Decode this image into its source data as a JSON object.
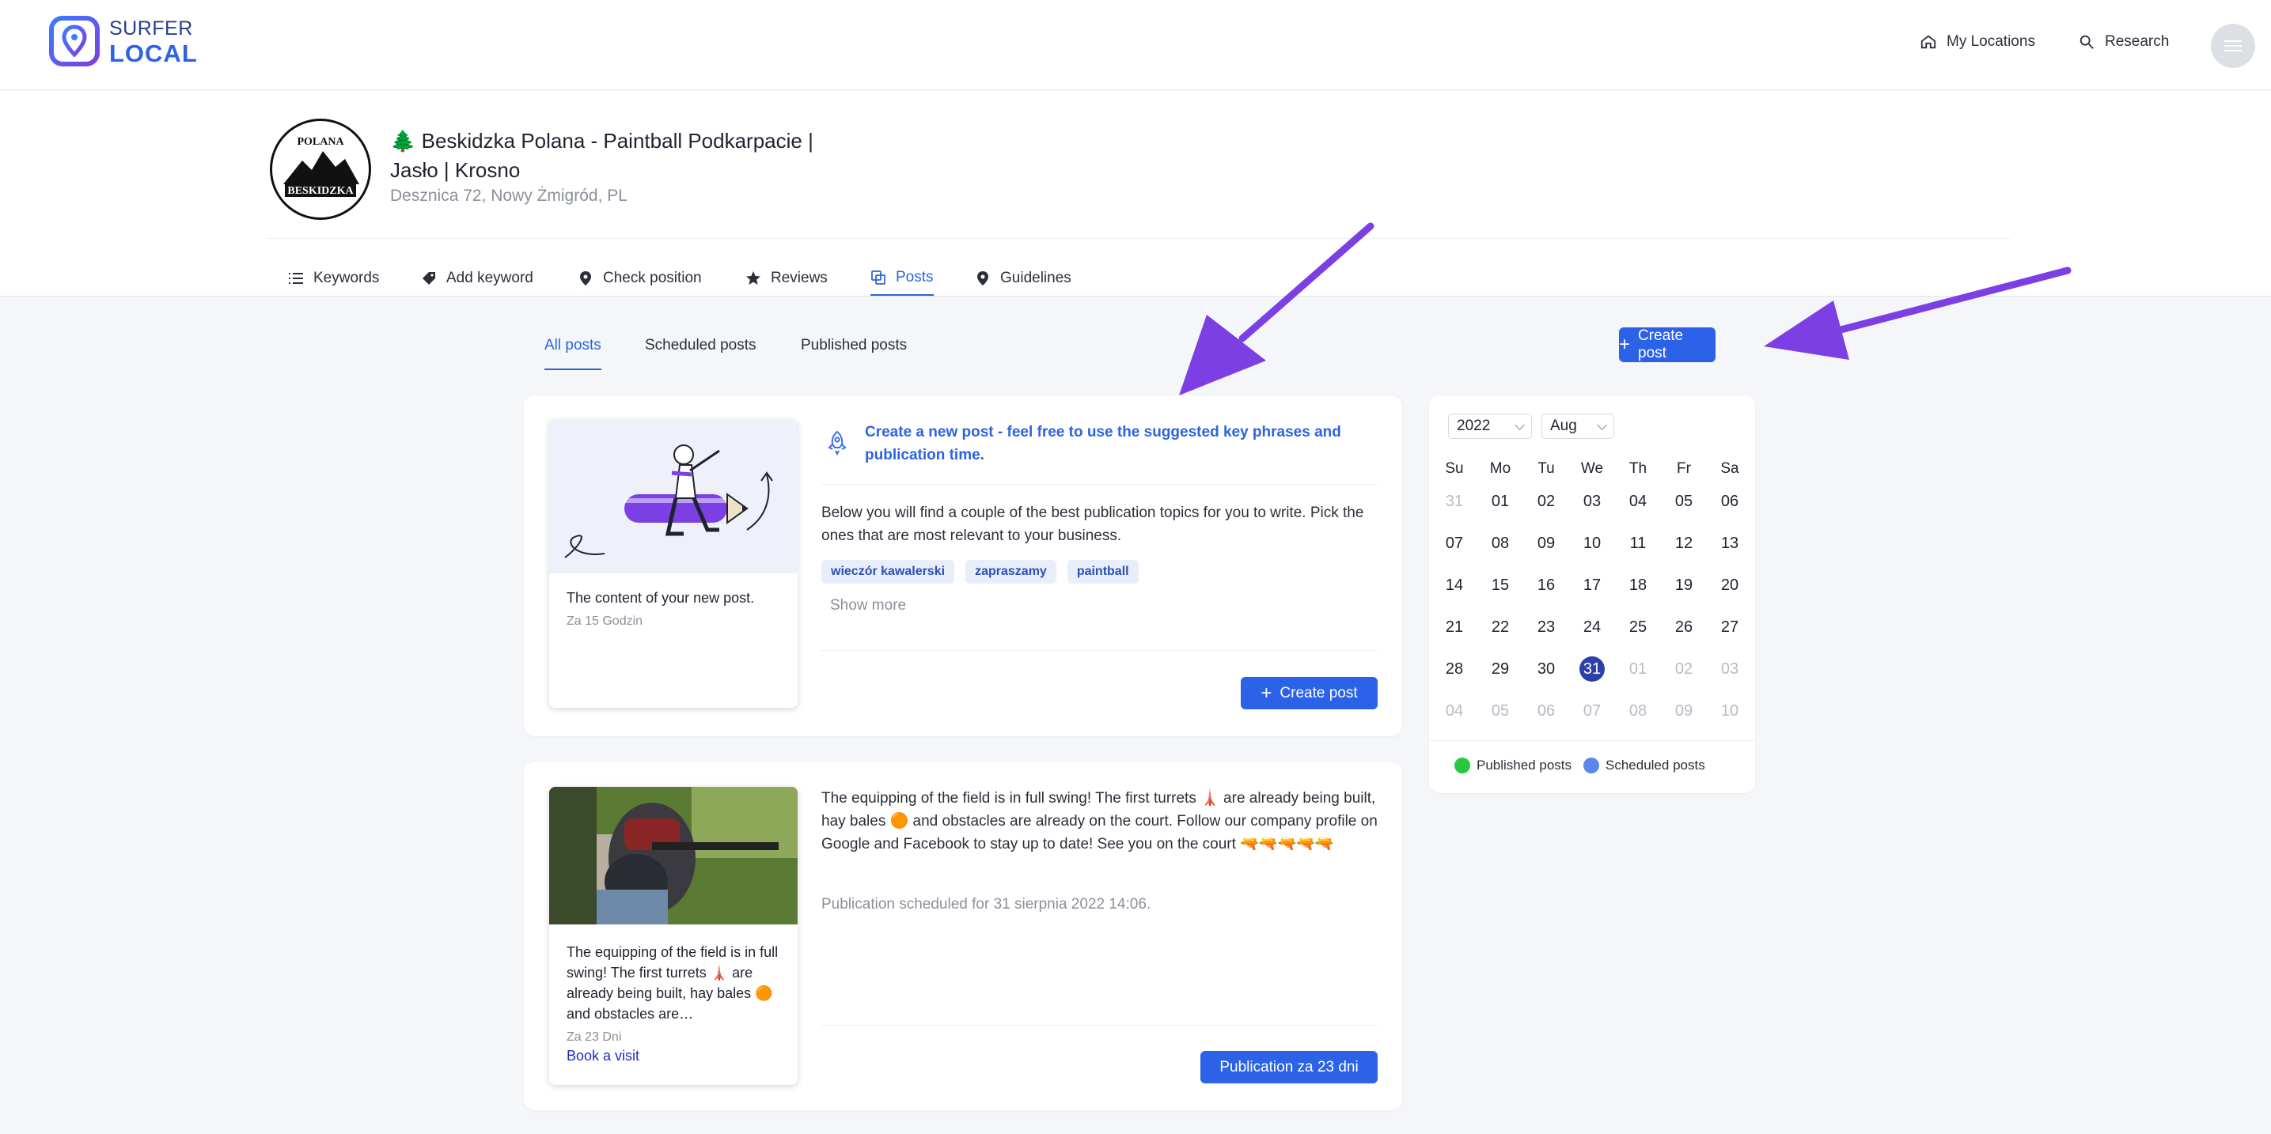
{
  "brand": {
    "line1": "SURFER",
    "line2": "LOCAL"
  },
  "topnav": {
    "my_locations": "My Locations",
    "research": "Research"
  },
  "business": {
    "name": "🌲 Beskidzka Polana - Paintball Podkarpacie | Jasło | Krosno",
    "address": "Desznica 72, Nowy Żmigród, PL",
    "logo_text": {
      "top": "POLANA",
      "bottom": "BESKIDZKA"
    }
  },
  "tabs": [
    "Keywords",
    "Add keyword",
    "Check position",
    "Reviews",
    "Posts",
    "Guidelines"
  ],
  "subtabs": [
    "All posts",
    "Scheduled posts",
    "Published posts"
  ],
  "create_post_label": "Create post",
  "new_post_card": {
    "title": "Create a new post - feel free to use the suggested key phrases and publication time.",
    "description": "Below you will find a couple of the best publication topics for you to write. Pick the ones that are most relevant to your business.",
    "keywords": [
      "wieczór kawalerski",
      "zapraszamy",
      "paintball"
    ],
    "show_more": "Show more",
    "thumb_text": "The content of your new post.",
    "thumb_time": "Za 15 Godzin",
    "button": "Create post"
  },
  "scheduled_card": {
    "text": "The equipping of the field is in full swing! The first turrets 🗼 are already being built, hay bales 🟠 and obstacles are already on the court. Follow our company profile on Google and Facebook to stay up to date! See you on the court 🔫🔫🔫🔫🔫",
    "scheduled_info": "Publication scheduled for 31 sierpnia 2022 14:06.",
    "thumb_text": "The equipping of the field is in full swing! The first turrets 🗼 are already being built, hay bales 🟠 and obstacles are…",
    "thumb_time": "Za 23 Dni",
    "thumb_link": "Book a visit",
    "button": "Publication za 23 dni"
  },
  "calendar": {
    "year": "2022",
    "month": "Aug",
    "weekdays": [
      "Su",
      "Mo",
      "Tu",
      "We",
      "Th",
      "Fr",
      "Sa"
    ],
    "weeks": [
      [
        "31",
        "01",
        "02",
        "03",
        "04",
        "05",
        "06"
      ],
      [
        "07",
        "08",
        "09",
        "10",
        "11",
        "12",
        "13"
      ],
      [
        "14",
        "15",
        "16",
        "17",
        "18",
        "19",
        "20"
      ],
      [
        "21",
        "22",
        "23",
        "24",
        "25",
        "26",
        "27"
      ],
      [
        "28",
        "29",
        "30",
        "31",
        "01",
        "02",
        "03"
      ],
      [
        "04",
        "05",
        "06",
        "07",
        "08",
        "09",
        "10"
      ]
    ],
    "selected": "31",
    "legend": [
      {
        "label": "Published posts",
        "color": "#28c840"
      },
      {
        "label": "Scheduled posts",
        "color": "#5b86ee"
      }
    ]
  },
  "colors": {
    "accent": "#2b62e8",
    "annotation_arrow": "#7b3fe4",
    "selected_day": "#2e3fa7"
  }
}
